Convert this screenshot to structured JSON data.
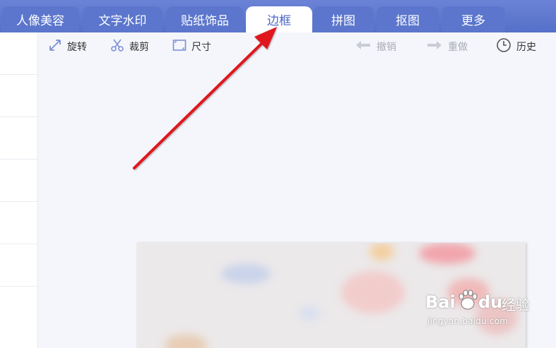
{
  "tabs": [
    {
      "label": "人像美容",
      "active": false
    },
    {
      "label": "文字水印",
      "active": false
    },
    {
      "label": "贴纸饰品",
      "active": false
    },
    {
      "label": "边框",
      "active": true
    },
    {
      "label": "拼图",
      "active": false
    },
    {
      "label": "抠图",
      "active": false
    },
    {
      "label": "更多",
      "active": false
    }
  ],
  "toolbar": {
    "rotate": "旋转",
    "crop": "裁剪",
    "size": "尺寸",
    "undo": "撤销",
    "redo": "重做",
    "history": "历史"
  },
  "watermark": {
    "brand_left": "Bai",
    "brand_right": "du",
    "brand_cn": "经验",
    "url": "jingyan.baidu.com"
  },
  "colors": {
    "tab_bar": "#5b76cc",
    "active_tab_text": "#4a66c3",
    "arrow": "#e0141b"
  }
}
